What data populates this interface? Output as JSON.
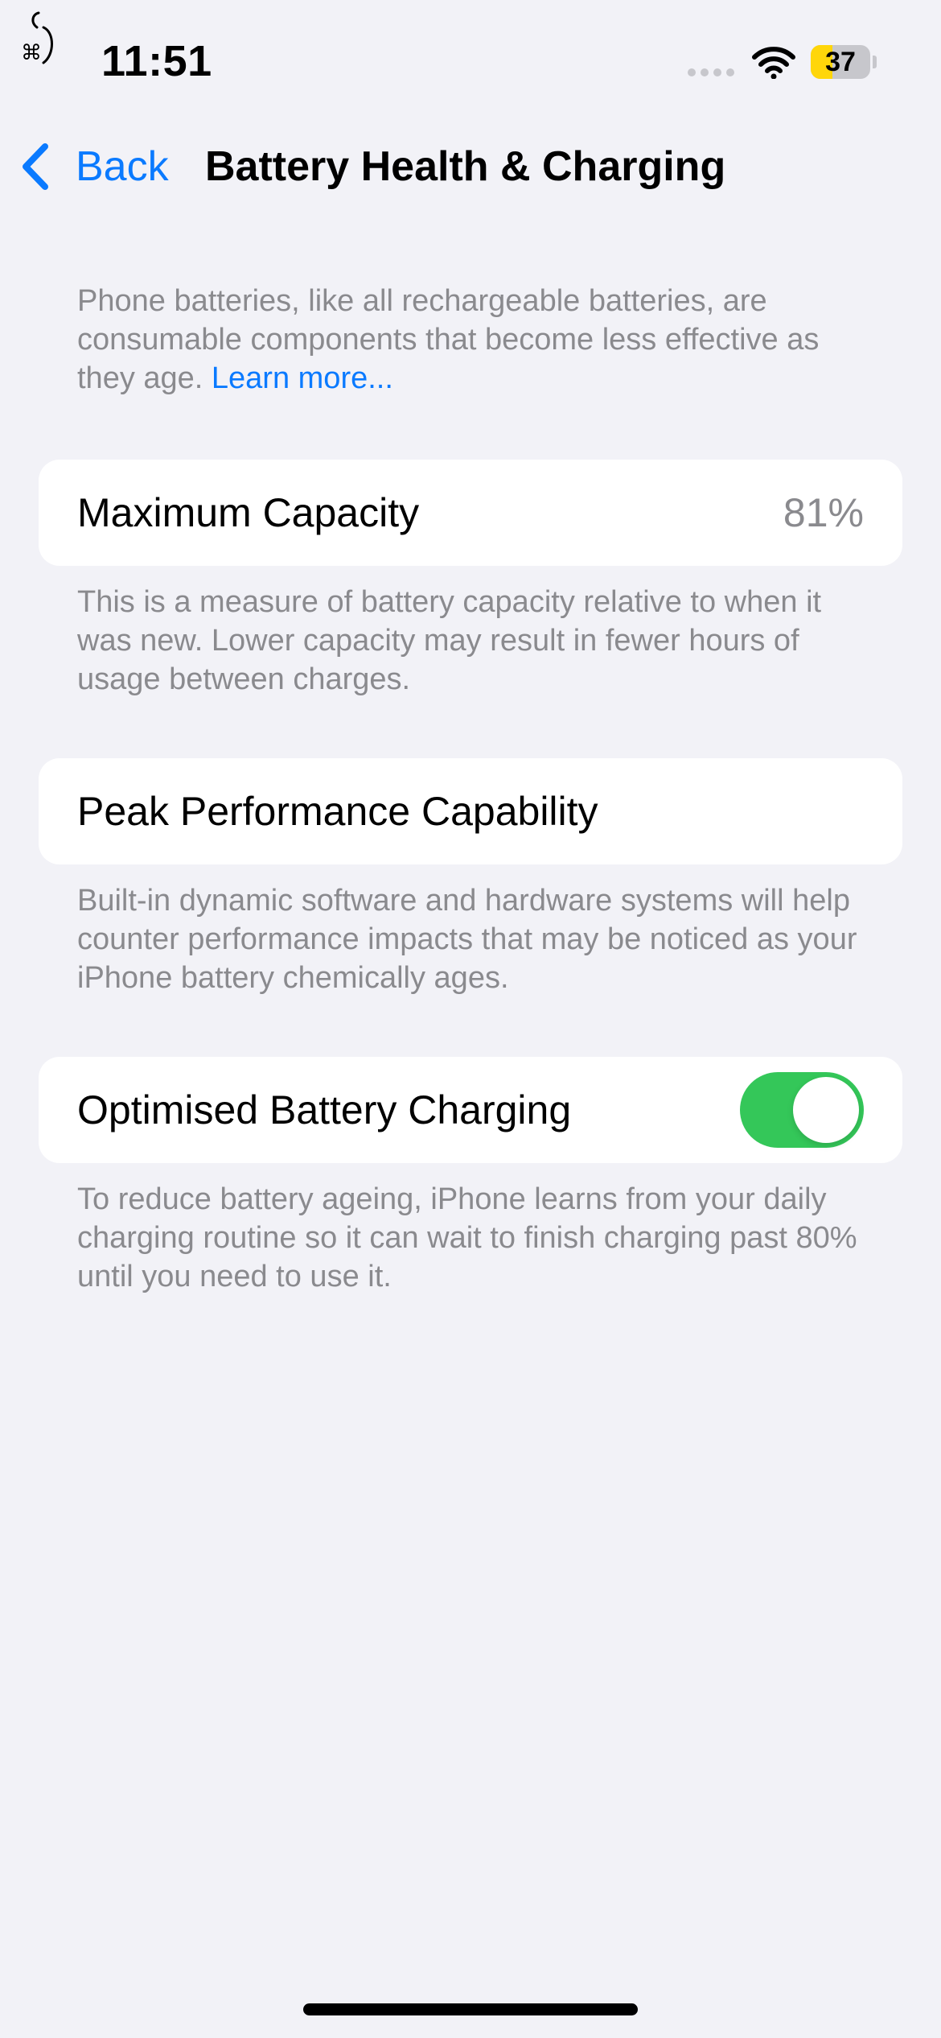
{
  "status_bar": {
    "time": "11:51",
    "battery_level": "37",
    "battery_percent": 37,
    "icons": [
      "focus-mode-icon",
      "cellular-signal-icon",
      "wifi-icon",
      "battery-icon"
    ]
  },
  "nav": {
    "back_label": "Back",
    "title": "Battery Health & Charging"
  },
  "intro": {
    "text": "Phone batteries, like all rechargeable batteries, are consumable components that become less effective as they age. ",
    "link": "Learn more..."
  },
  "maximum_capacity": {
    "label": "Maximum Capacity",
    "value": "81%",
    "description": "This is a measure of battery capacity relative to when it was new. Lower capacity may result in fewer hours of usage between charges."
  },
  "peak_performance": {
    "label": "Peak Performance Capability",
    "description": "Built-in dynamic software and hardware systems will help counter performance impacts that may be noticed as your iPhone battery chemically ages."
  },
  "optimised_charging": {
    "label": "Optimised Battery Charging",
    "enabled": true,
    "description": "To reduce battery ageing, iPhone learns from your daily charging routine so it can wait to finish charging past 80% until you need to use it."
  },
  "colors": {
    "accent": "#0a7aff",
    "toggle_on": "#34c759",
    "background": "#f2f2f7",
    "secondary_text": "#8a8a8e",
    "battery_fill": "#ffd60a"
  }
}
